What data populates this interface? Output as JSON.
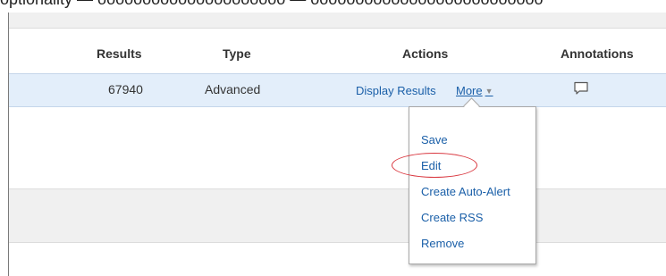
{
  "top_partial_text": "optionality — ooooooooooooooooooooo — oooooooooooooooooooooooooo",
  "table": {
    "headers": {
      "results": "Results",
      "type": "Type",
      "actions": "Actions",
      "annotations": "Annotations"
    },
    "row": {
      "results": "67940",
      "type": "Advanced",
      "display_results": "Display Results",
      "more": "More",
      "more_caret": "▼",
      "annotation_icon": "comment-icon"
    }
  },
  "dropdown": {
    "items": [
      {
        "label": "Save"
      },
      {
        "label": "Edit"
      },
      {
        "label": "Create Auto-Alert"
      },
      {
        "label": "Create RSS"
      },
      {
        "label": "Remove"
      }
    ],
    "highlighted_item": "Edit"
  },
  "colors": {
    "link": "#1a5fa8",
    "selected_row": "#e3eefa",
    "band": "#f0f0f0",
    "highlight": "#d9363e"
  }
}
